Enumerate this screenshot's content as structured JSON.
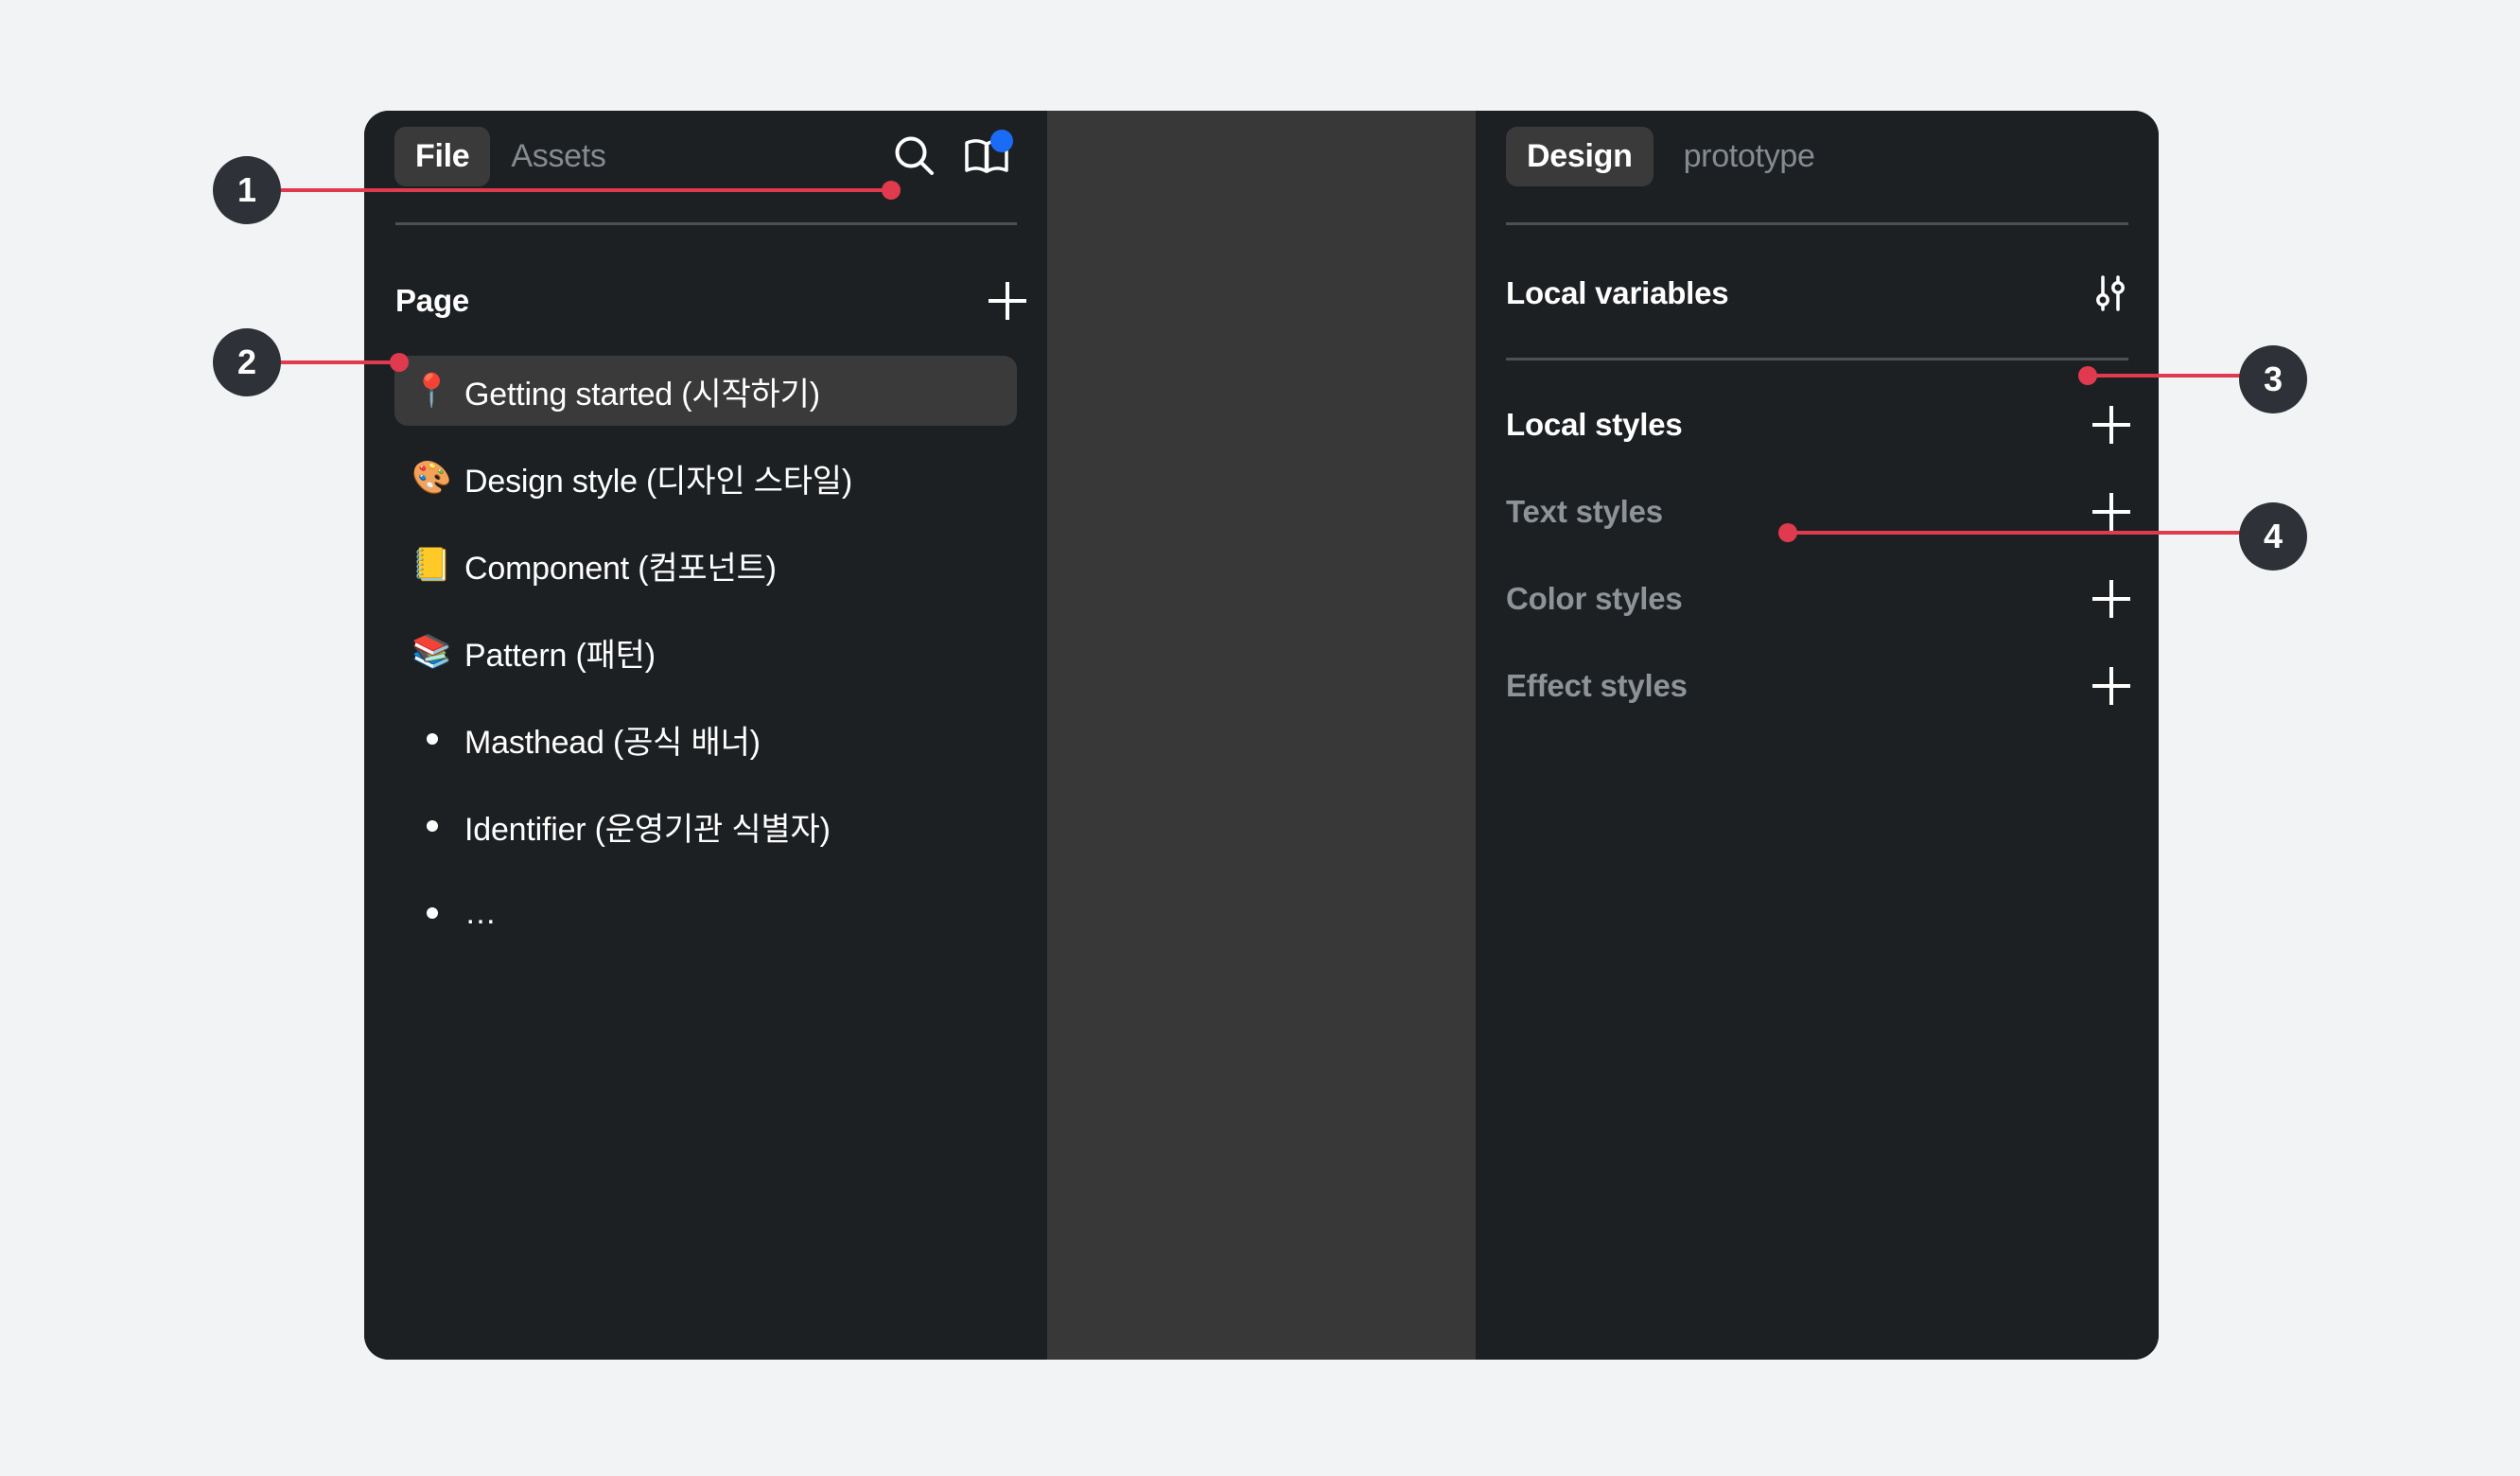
{
  "window": {
    "left_panel": {
      "tabs": [
        {
          "label": "File",
          "active": true
        },
        {
          "label": "Assets",
          "active": false
        }
      ],
      "icons": [
        {
          "name": "search-icon"
        },
        {
          "name": "book-icon",
          "badge": true
        }
      ],
      "page_section": {
        "title": "Page",
        "add_label": "+"
      },
      "pages": [
        {
          "emoji": "📍",
          "label": "Getting started (시작하기)",
          "selected": true
        },
        {
          "emoji": "🎨",
          "label": "Design style (디자인 스타일)",
          "selected": false
        },
        {
          "emoji": "📒",
          "label": "Component (컴포넌트)",
          "selected": false
        },
        {
          "emoji": "📚",
          "label": "Pattern (패턴)",
          "selected": false
        }
      ],
      "sub_pages": [
        {
          "label": "Masthead (공식 배너)"
        },
        {
          "label": "Identifier (운영기관 식별자)"
        },
        {
          "label": "…"
        }
      ]
    },
    "right_panel": {
      "tabs": [
        {
          "label": "Design",
          "active": true
        },
        {
          "label": "prototype",
          "active": false
        }
      ],
      "sections": [
        {
          "label": "Local variables",
          "action": "sliders",
          "muted": false
        },
        {
          "label": "Local styles",
          "action": "plus",
          "muted": false
        },
        {
          "label": "Text styles",
          "action": "plus",
          "muted": true
        },
        {
          "label": "Color styles",
          "action": "plus",
          "muted": true
        },
        {
          "label": "Effect styles",
          "action": "plus",
          "muted": true
        }
      ]
    }
  },
  "callouts": [
    {
      "number": "1"
    },
    {
      "number": "2"
    },
    {
      "number": "3"
    },
    {
      "number": "4"
    }
  ],
  "colors": {
    "page_background": "#f2f3f5",
    "panel_background": "#1d2023",
    "canvas_background": "#383838",
    "accent_red": "#e03a4e",
    "badge_background": "#2e3238",
    "notification_blue": "#1a6bf5",
    "active_tab_background": "#3a3a3a",
    "muted_text": "#8e9398"
  }
}
